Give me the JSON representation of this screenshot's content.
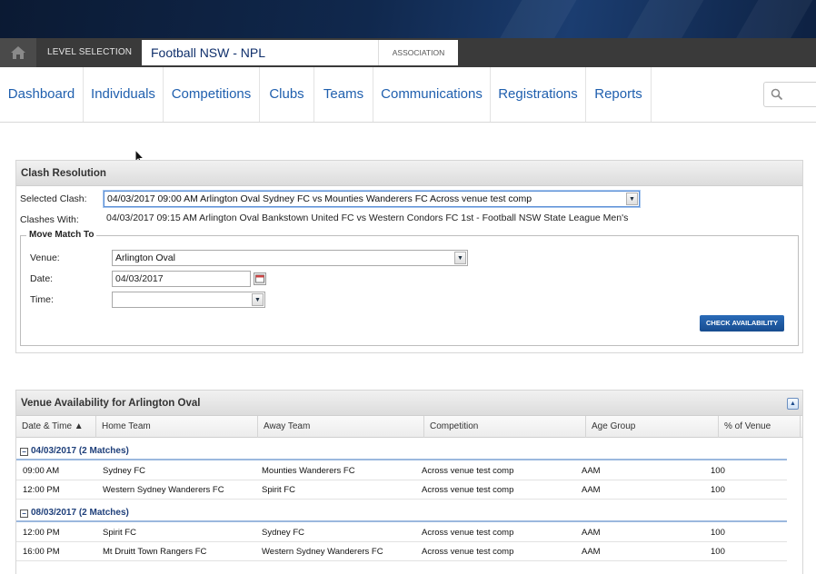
{
  "topbar": {
    "level_label": "LEVEL SELECTION",
    "level_value": "Football NSW - NPL",
    "level_type": "ASSOCIATION"
  },
  "nav": {
    "items": [
      "Dashboard",
      "Individuals",
      "Competitions",
      "Clubs",
      "Teams",
      "Communications",
      "Registrations",
      "Reports"
    ]
  },
  "clash": {
    "title": "Clash Resolution",
    "selected_label": "Selected Clash:",
    "selected_value": "04/03/2017 09:00 AM Arlington Oval Sydney FC vs Mounties Wanderers FC Across venue test comp",
    "clashes_label": "Clashes With:",
    "clashes_value": "04/03/2017 09:15 AM Arlington Oval Bankstown United FC vs Western Condors FC 1st - Football NSW State League Men's",
    "move_legend": "Move Match To",
    "venue_label": "Venue:",
    "venue_value": "Arlington Oval",
    "date_label": "Date:",
    "date_value": "04/03/2017",
    "time_label": "Time:",
    "time_value": "",
    "check_button": "CHECK AVAILABILITY"
  },
  "venue": {
    "title": "Venue Availability for Arlington Oval",
    "columns": [
      "Date & Time ▲",
      "Home Team",
      "Away Team",
      "Competition",
      "Age Group",
      "% of Venue"
    ],
    "groups": [
      {
        "label": "04/03/2017 (2 Matches)",
        "rows": [
          {
            "time": "09:00 AM",
            "home": "Sydney FC",
            "away": "Mounties Wanderers FC",
            "comp": "Across venue test comp",
            "age": "AAM",
            "pct": "100"
          },
          {
            "time": "12:00 PM",
            "home": "Western Sydney Wanderers FC",
            "away": "Spirit FC",
            "comp": "Across venue test comp",
            "age": "AAM",
            "pct": "100"
          }
        ]
      },
      {
        "label": "08/03/2017 (2 Matches)",
        "rows": [
          {
            "time": "12:00 PM",
            "home": "Spirit FC",
            "away": "Sydney FC",
            "comp": "Across venue test comp",
            "age": "AAM",
            "pct": "100"
          },
          {
            "time": "16:00 PM",
            "home": "Mt Druitt Town Rangers FC",
            "away": "Western Sydney Wanderers FC",
            "comp": "Across venue test comp",
            "age": "AAM",
            "pct": "100"
          }
        ]
      }
    ]
  }
}
